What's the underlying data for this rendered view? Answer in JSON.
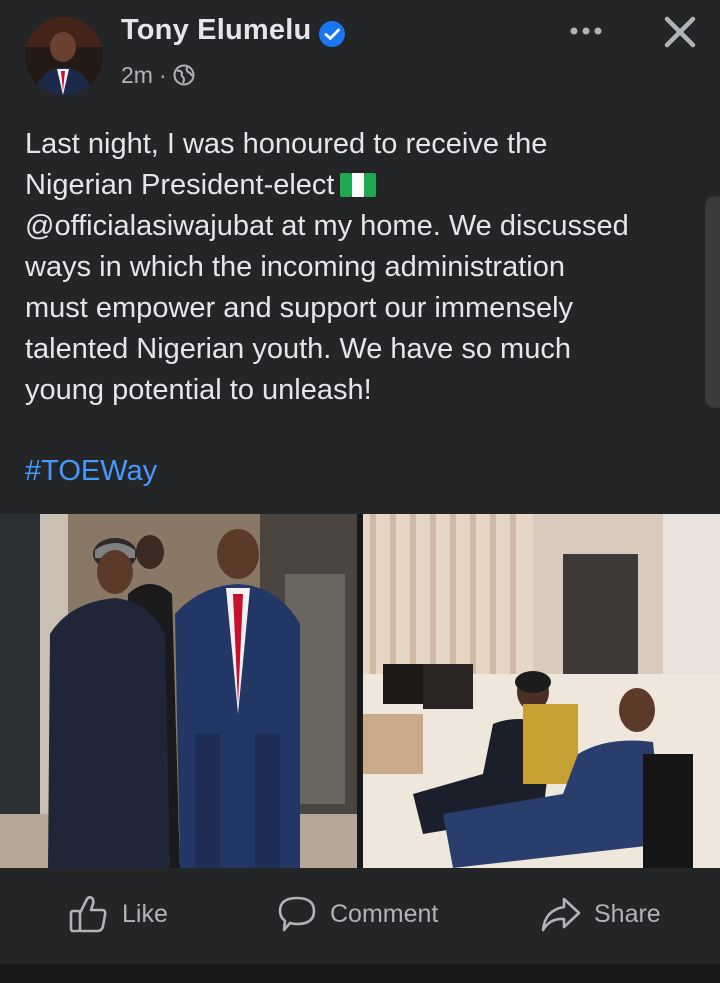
{
  "post": {
    "author": "Tony Elumelu",
    "verified": true,
    "time": "2m",
    "separator": "·",
    "privacy_icon": "globe-icon",
    "text_lines": [
      "Last night, I was honoured to receive the",
      "Nigerian President-elect",
      "@officialasiwajubat at my home. We discussed",
      "ways in which the incoming administration",
      "must empower and support our immensely",
      "talented Nigerian youth. We have so much",
      "young potential to unleash!"
    ],
    "hashtag": "#TOEWay",
    "flag_icon": "nigeria-flag-icon"
  },
  "actions": {
    "like": "Like",
    "comment": "Comment",
    "share": "Share"
  },
  "colors": {
    "background": "#242526",
    "text": "#e4e6eb",
    "secondary_text": "#b0b3b8",
    "link": "#4599ff",
    "verified": "#1877f2"
  }
}
